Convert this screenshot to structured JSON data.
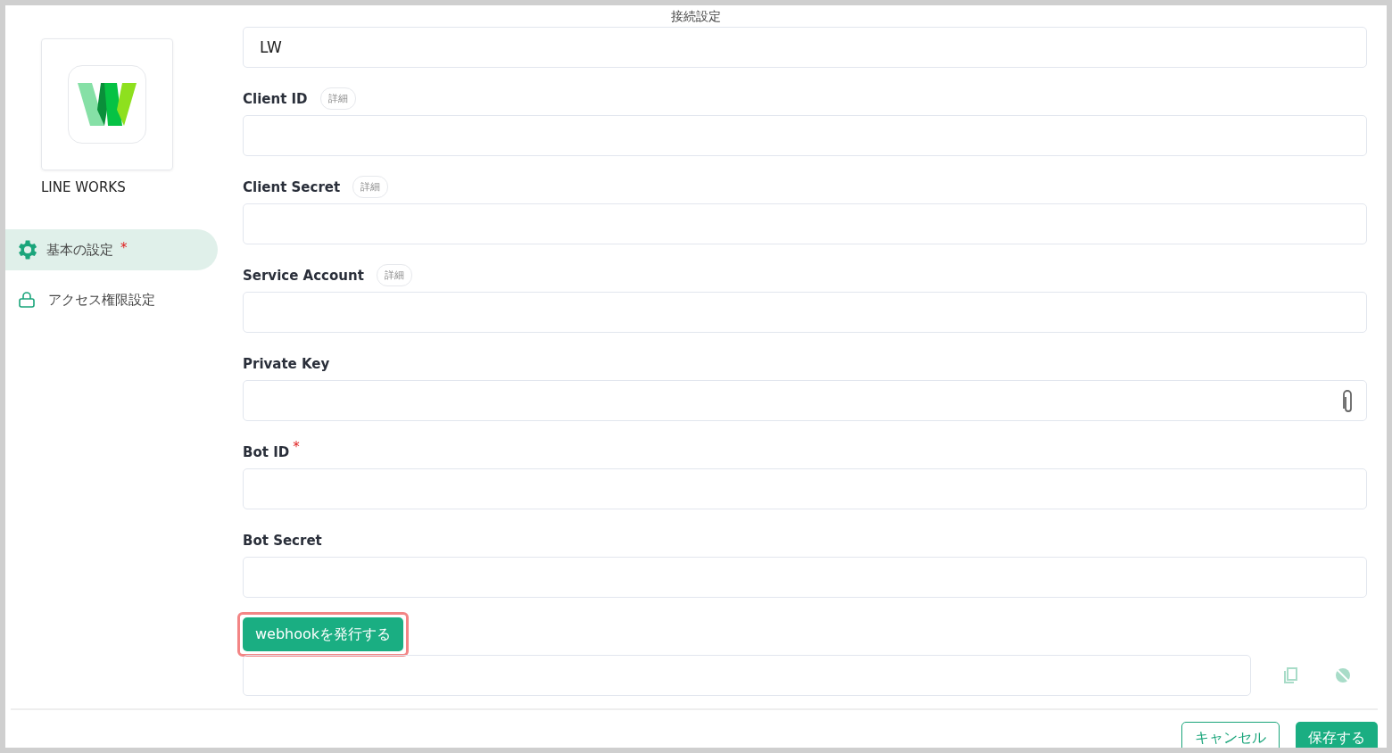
{
  "window": {
    "title": "接続設定"
  },
  "app": {
    "name": "LINE WORKS"
  },
  "nav": [
    {
      "label": "基本の設定",
      "kind": "gear",
      "selected": true,
      "required_mark": "*"
    },
    {
      "label": "アクセス権限設定",
      "kind": "lock",
      "selected": false
    }
  ],
  "fields": [
    {
      "kind": "text",
      "value": "LW"
    },
    {
      "kind": "text",
      "label": "Client ID",
      "detail": "詳細"
    },
    {
      "kind": "text",
      "label": "Client Secret",
      "detail": "詳細"
    },
    {
      "kind": "text",
      "label": "Service Account",
      "detail": "詳細"
    },
    {
      "kind": "file",
      "label": "Private Key"
    },
    {
      "kind": "text",
      "label": "Bot ID",
      "required_mark": "*"
    },
    {
      "kind": "text",
      "label": "Bot Secret"
    }
  ],
  "webhook": {
    "button": "webhookを発行する",
    "highlighted": true
  },
  "footer": {
    "cancel": "キャンセル",
    "save": "保存する"
  }
}
